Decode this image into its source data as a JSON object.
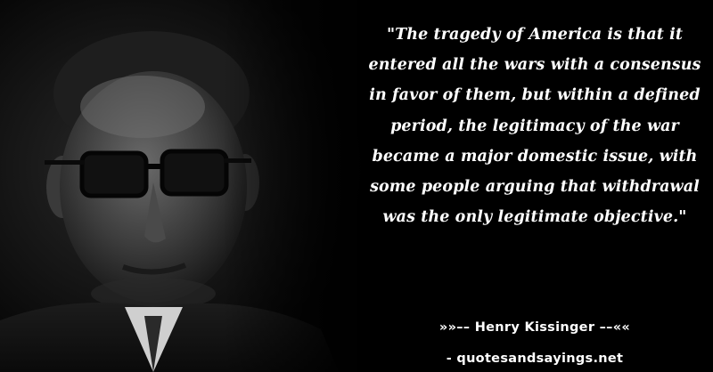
{
  "quote": {
    "text": "\"The tragedy of America is that it entered all the wars with a consensus in favor of them, but within a defined period, the legitimacy of the war became a major domestic issue, with some people arguing that withdrawal was the only legitimate objective.\""
  },
  "attribution": {
    "author_line": "»»–– Henry Kissinger ––««",
    "site_line": "- quotesandsayings.net"
  },
  "colors": {
    "background": "#000000",
    "text": "#ffffff"
  }
}
